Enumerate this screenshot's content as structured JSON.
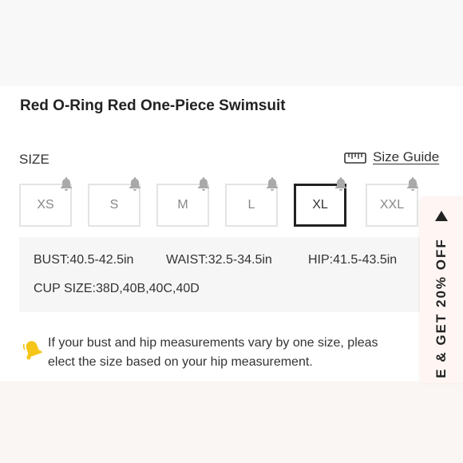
{
  "product": {
    "title": "Red O-Ring Red One-Piece Swimsuit"
  },
  "size_section": {
    "label": "SIZE",
    "size_guide_label": "Size Guide",
    "options": [
      {
        "label": "XS",
        "selected": false
      },
      {
        "label": "S",
        "selected": false
      },
      {
        "label": "M",
        "selected": false
      },
      {
        "label": "L",
        "selected": false
      },
      {
        "label": "XL",
        "selected": true
      },
      {
        "label": "XXL",
        "selected": false
      }
    ]
  },
  "measurements": {
    "bust_key": "BUST",
    "bust_value": ":40.5-42.5in",
    "waist_key": "WAIST",
    "waist_value": ":32.5-34.5in",
    "hip_key": "HIP",
    "hip_value": ":41.5-43.5in",
    "cup_key": "CUP SIZE",
    "cup_value": ":38D,40B,40C,40D"
  },
  "note": {
    "line1": "If your bust and hip measurements vary by one size, pleas",
    "line2": "elect the size based on your hip measurement."
  },
  "promo": {
    "text": "E & GET 20% OFF"
  },
  "colors": {
    "selected_border": "#222222",
    "promo_bg": "#fff6f3",
    "note_icon": "#f5c518"
  }
}
